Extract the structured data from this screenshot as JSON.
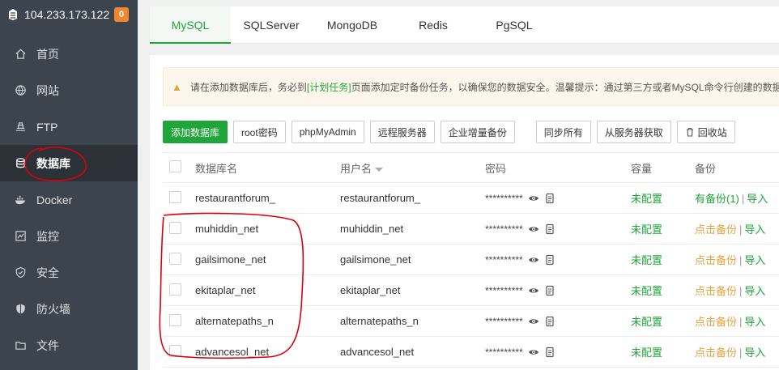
{
  "server": {
    "ip": "104.233.173.122",
    "badge": "0"
  },
  "sidebar": {
    "items": [
      {
        "label": "首页",
        "icon": "home-icon"
      },
      {
        "label": "网站",
        "icon": "globe-icon"
      },
      {
        "label": "FTP",
        "icon": "ftp-icon"
      },
      {
        "label": "数据库",
        "icon": "database-icon",
        "active": true
      },
      {
        "label": "Docker",
        "icon": "docker-icon"
      },
      {
        "label": "监控",
        "icon": "monitor-icon"
      },
      {
        "label": "安全",
        "icon": "shield-icon"
      },
      {
        "label": "防火墙",
        "icon": "firewall-icon"
      },
      {
        "label": "文件",
        "icon": "folder-icon"
      }
    ]
  },
  "tabs": [
    "MySQL",
    "SQLServer",
    "MongoDB",
    "Redis",
    "PgSQL"
  ],
  "notice": {
    "pre": "请在添加数据库后，务必到",
    "link": "[计划任务]",
    "post": "页面添加定时备份任务，以确保您的数据安全。温馨提示：通过第三方或者MySQL命令行创建的数据"
  },
  "toolbar": {
    "add_db": "添加数据库",
    "root_pw": "root密码",
    "phpmyadmin": "phpMyAdmin",
    "remote": "远程服务器",
    "enterprise": "企业增量备份",
    "sync_all": "同步所有",
    "from_server": "从服务器获取",
    "recycle": "回收站"
  },
  "table": {
    "headers": {
      "name": "数据库名",
      "user": "用户名",
      "password": "密码",
      "capacity": "容量",
      "backup": "备份"
    },
    "rows": [
      {
        "name": "restaurantforum_",
        "user": "restaurantforum_",
        "password": "**********",
        "capacity": "未配置",
        "backup": "有备份(1)",
        "import": "导入"
      },
      {
        "name": "muhiddin_net",
        "user": "muhiddin_net",
        "password": "**********",
        "capacity": "未配置",
        "backup": "点击备份",
        "import": "导入"
      },
      {
        "name": "gailsimone_net",
        "user": "gailsimone_net",
        "password": "**********",
        "capacity": "未配置",
        "backup": "点击备份",
        "import": "导入"
      },
      {
        "name": "ekitaplar_net",
        "user": "ekitaplar_net",
        "password": "**********",
        "capacity": "未配置",
        "backup": "点击备份",
        "import": "导入"
      },
      {
        "name": "alternatepaths_n",
        "user": "alternatepaths_n",
        "password": "**********",
        "capacity": "未配置",
        "backup": "点击备份",
        "import": "导入"
      },
      {
        "name": "advancesol_net",
        "user": "advancesol_net",
        "password": "**********",
        "capacity": "未配置",
        "backup": "点击备份",
        "import": "导入"
      }
    ]
  },
  "colors": {
    "accent": "#20a53a",
    "sidebar_bg": "#3c444d",
    "backup_link": "#e8a23b",
    "annotation": "#d9000d"
  }
}
